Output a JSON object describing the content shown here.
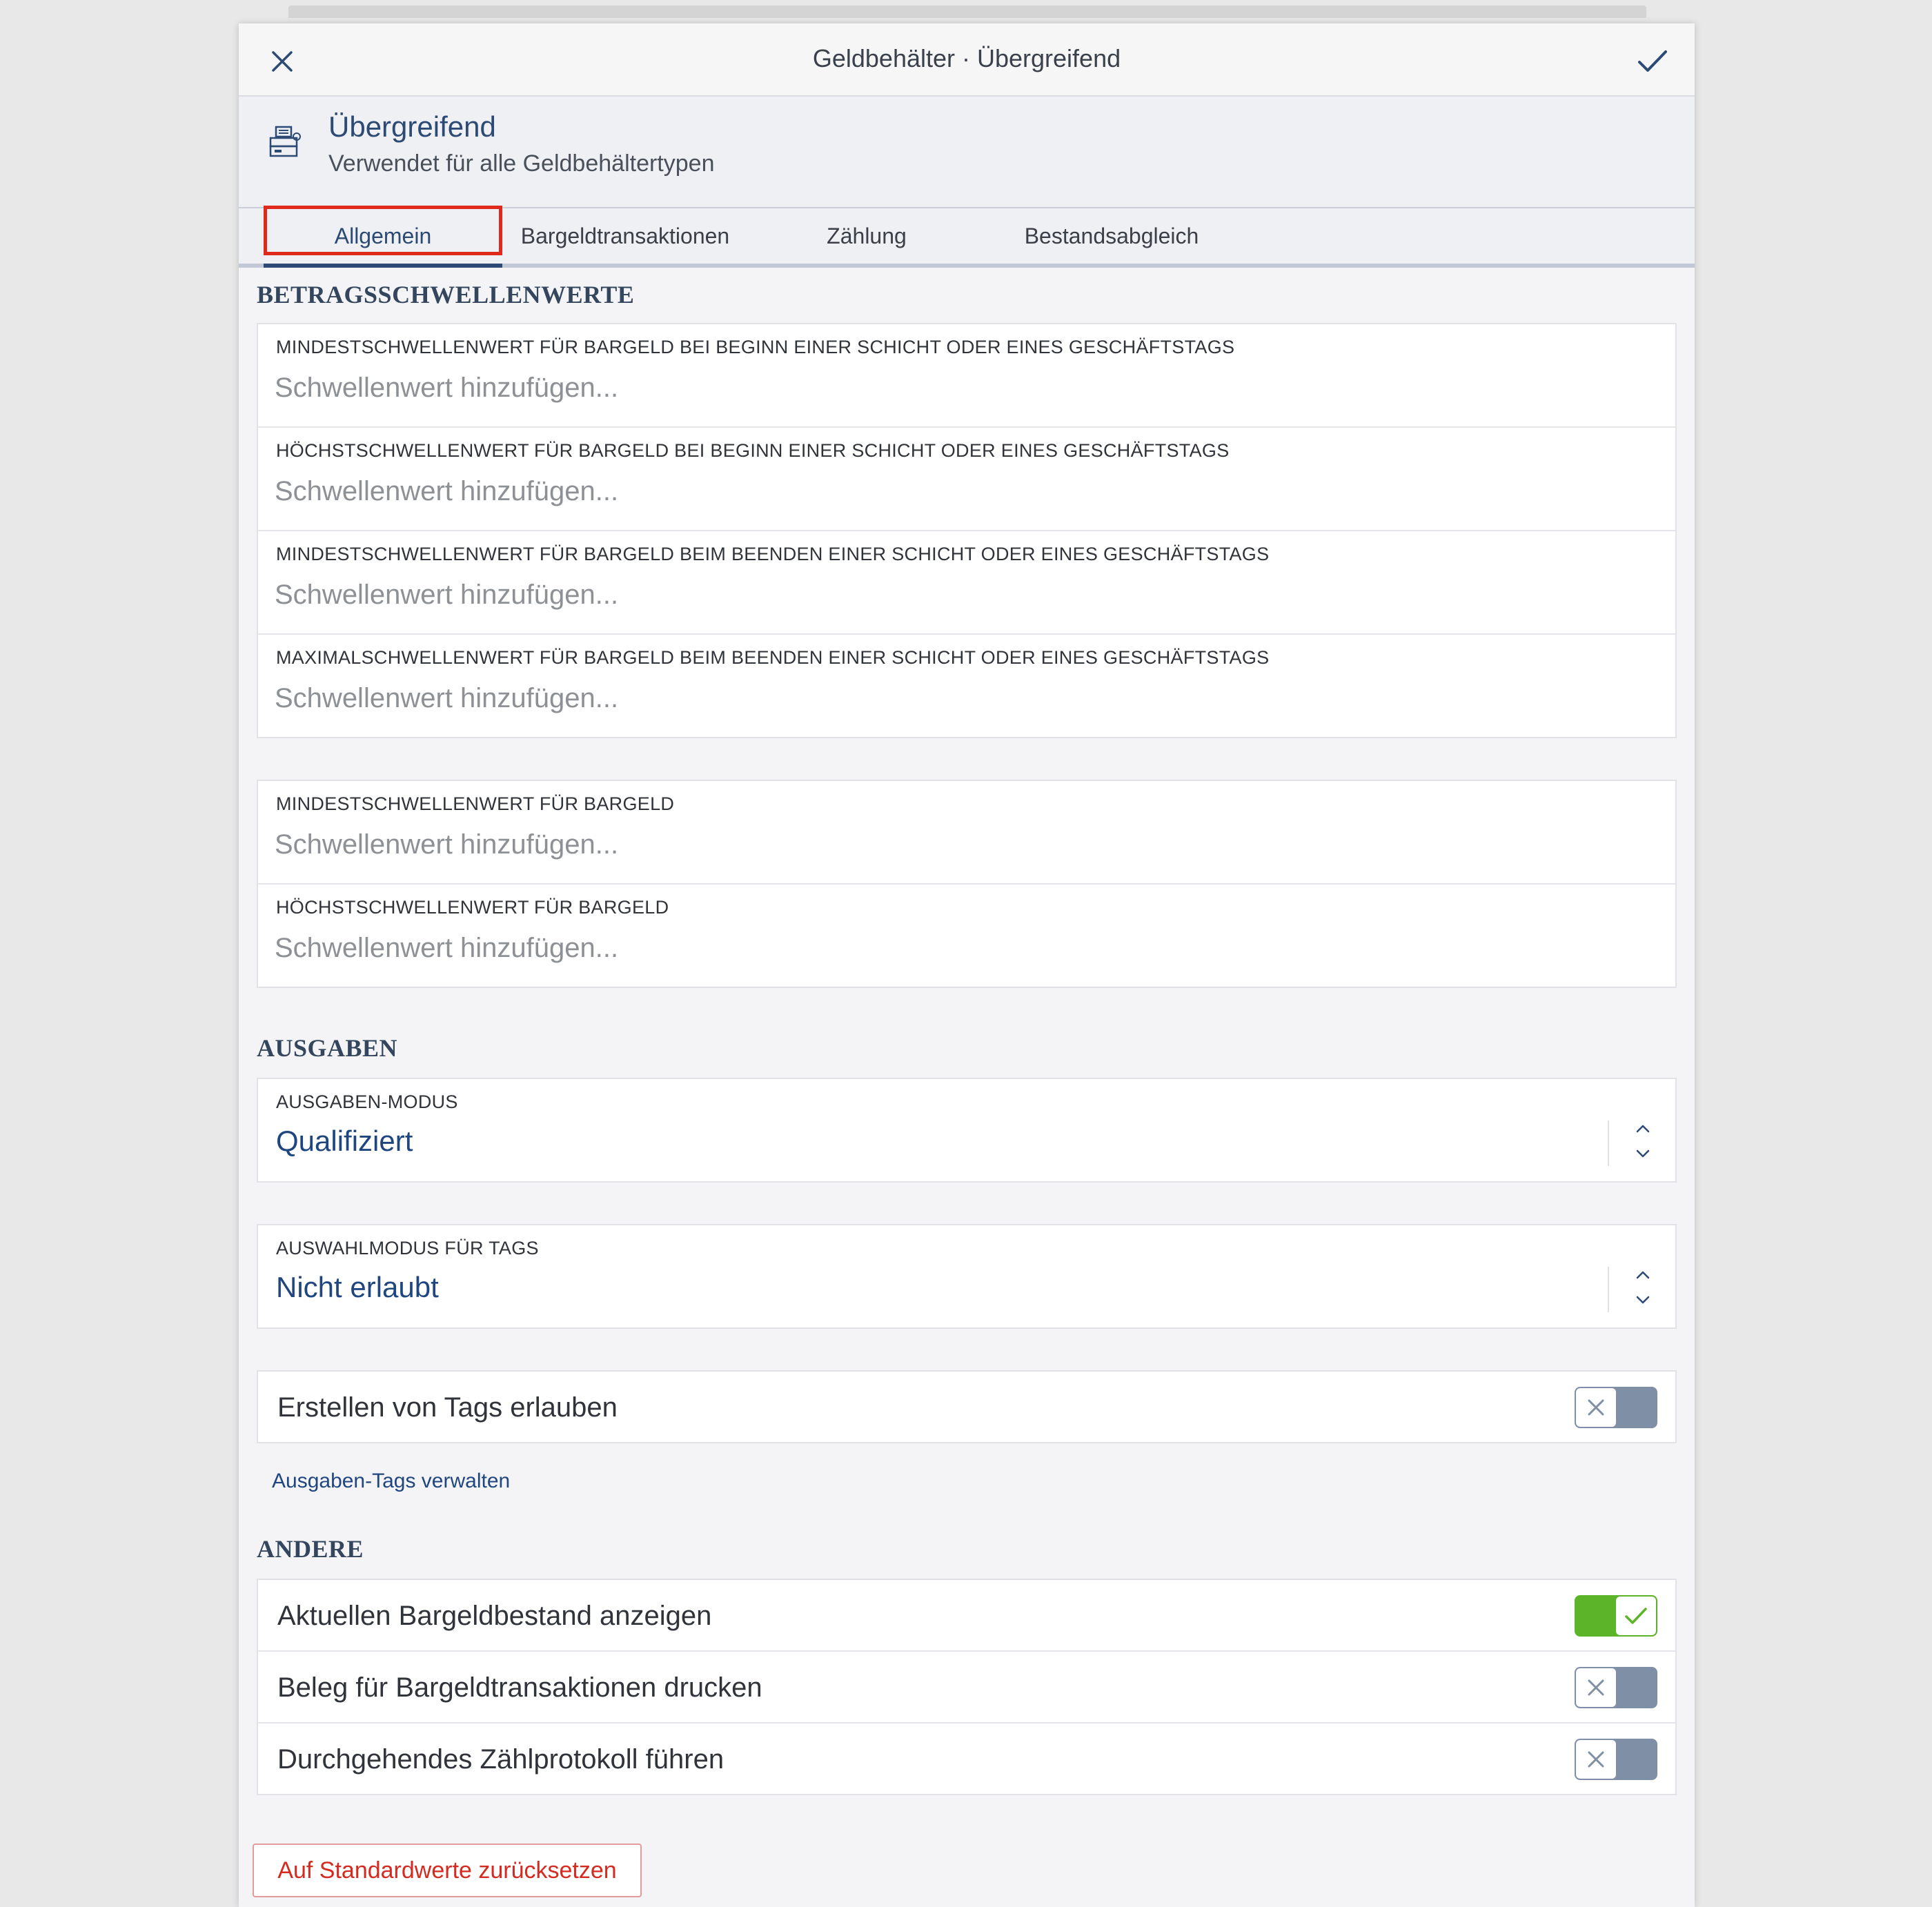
{
  "window": {
    "title": "Geldbehälter · Übergreifend"
  },
  "header": {
    "title": "Übergreifend",
    "subtitle": "Verwendet für alle Geldbehältertypen",
    "icon": "cash-drawer-icon"
  },
  "tabs": [
    {
      "label": "Allgemein",
      "active": true
    },
    {
      "label": "Bargeldtransaktionen",
      "active": false
    },
    {
      "label": "Zählung",
      "active": false
    },
    {
      "label": "Bestandsabgleich",
      "active": false
    }
  ],
  "thresholds": {
    "section_title": "BETRAGSSCHWELLENWERTE",
    "shift_fields": [
      {
        "label": "MINDESTSCHWELLENWERT FÜR BARGELD BEI BEGINN EINER SCHICHT ODER EINES GESCHÄFTSTAGS",
        "value": "",
        "placeholder": "Schwellenwert hinzufügen..."
      },
      {
        "label": "HÖCHSTSCHWELLENWERT FÜR BARGELD BEI BEGINN EINER SCHICHT ODER EINES GESCHÄFTSTAGS",
        "value": "",
        "placeholder": "Schwellenwert hinzufügen..."
      },
      {
        "label": "MINDESTSCHWELLENWERT FÜR BARGELD BEIM BEENDEN EINER SCHICHT ODER EINES GESCHÄFTSTAGS",
        "value": "",
        "placeholder": "Schwellenwert hinzufügen..."
      },
      {
        "label": "MAXIMALSCHWELLENWERT FÜR BARGELD BEIM BEENDEN EINER SCHICHT ODER EINES GESCHÄFTSTAGS",
        "value": "",
        "placeholder": "Schwellenwert hinzufügen..."
      }
    ],
    "cash_fields": [
      {
        "label": "MINDESTSCHWELLENWERT FÜR BARGELD",
        "value": "",
        "placeholder": "Schwellenwert hinzufügen..."
      },
      {
        "label": "HÖCHSTSCHWELLENWERT FÜR BARGELD",
        "value": "",
        "placeholder": "Schwellenwert hinzufügen..."
      }
    ]
  },
  "expenses": {
    "section_title": "AUSGABEN",
    "mode": {
      "label": "AUSGABEN-MODUS",
      "value": "Qualifiziert"
    },
    "tag_mode": {
      "label": "AUSWAHLMODUS FÜR TAGS",
      "value": "Nicht erlaubt"
    },
    "allow_tags": {
      "label": "Erstellen von Tags erlauben",
      "enabled": false
    },
    "manage_link": "Ausgaben-Tags verwalten"
  },
  "other": {
    "section_title": "ANDERE",
    "toggles": [
      {
        "label": "Aktuellen Bargeldbestand anzeigen",
        "enabled": true
      },
      {
        "label": "Beleg für Bargeldtransaktionen drucken",
        "enabled": false
      },
      {
        "label": "Durchgehendes Zählprotokoll führen",
        "enabled": false
      }
    ]
  },
  "footer": {
    "reset_label": "Auf Standardwerte zurücksetzen"
  },
  "colors": {
    "accent": "#2c4a73",
    "toggle_on": "#5cb528",
    "toggle_off": "#7f8fa6",
    "danger": "#d42a1f",
    "highlight": "#e0291d"
  }
}
